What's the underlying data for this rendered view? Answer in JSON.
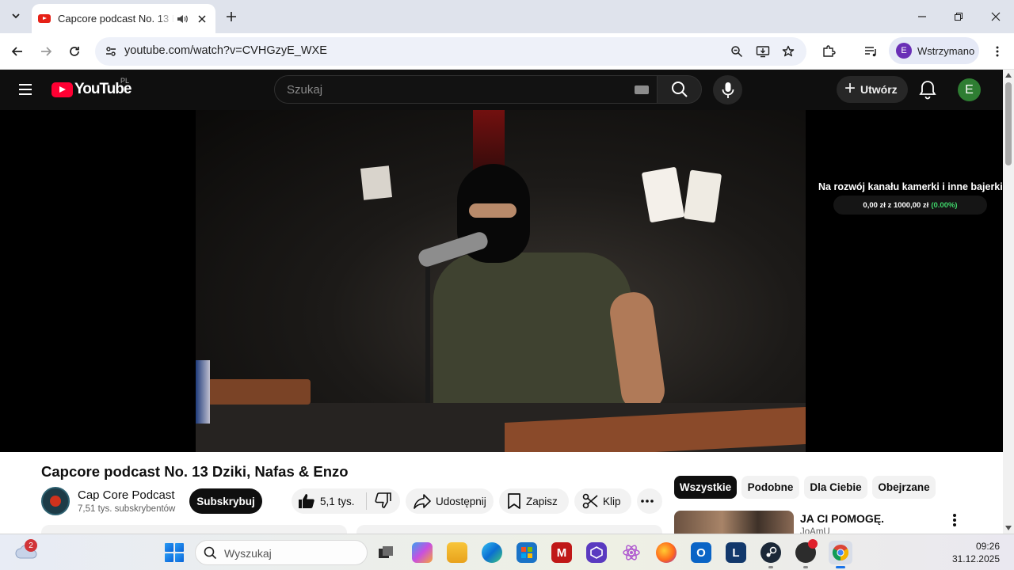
{
  "browser": {
    "tab": {
      "title": "Capcore podcast No. 13 Dziki, Nafas & Enzo"
    },
    "url": "youtube.com/watch?v=CVHGzyE_WXE",
    "profile_label": "Wstrzymano",
    "profile_initial": "E"
  },
  "youtube": {
    "logo_text": "YouTube",
    "country_code": "PL",
    "search_placeholder": "Szukaj",
    "create_label": "Utwórz",
    "avatar_initial": "E"
  },
  "player": {
    "overlay_title": "Na rozwój kanału kamerki i inne bajerki",
    "overlay_progress": "0,00 zł z 1000,00 zł",
    "overlay_percent": "(0.00%)"
  },
  "video": {
    "title": "Capcore podcast No. 13 Dziki, Nafas & Enzo",
    "channel_name": "Cap Core Podcast",
    "subscribers": "7,51 tys. subskrybentów",
    "subscribe_label": "Subskrybuj",
    "likes": "5,1 tys.",
    "share_label": "Udostępnij",
    "save_label": "Zapisz",
    "clip_label": "Klip"
  },
  "sidebar": {
    "chips": [
      {
        "label": "Wszystkie",
        "active": true
      },
      {
        "label": "Podobne",
        "active": false
      },
      {
        "label": "Dla Ciebie",
        "active": false
      },
      {
        "label": "Obejrzane",
        "active": false
      }
    ],
    "recommendation": {
      "title": "JA CI POMOGĘ.",
      "channel": "JoAmU"
    }
  },
  "taskbar": {
    "weather_badge": "2",
    "search_placeholder": "Wyszukaj",
    "time": "09:26",
    "date": "31.12.2025",
    "apps": [
      "task-view",
      "copilot",
      "file-explorer",
      "edge",
      "microsoft-store",
      "mcafee",
      "proton-vpn",
      "react-app",
      "firefox",
      "outlook",
      "l-app",
      "steam",
      "obs",
      "chrome"
    ]
  },
  "colors": {
    "youtube_red": "#ff0033",
    "youtube_dark": "#0f0f0f",
    "progress_green": "#3fd86b"
  }
}
